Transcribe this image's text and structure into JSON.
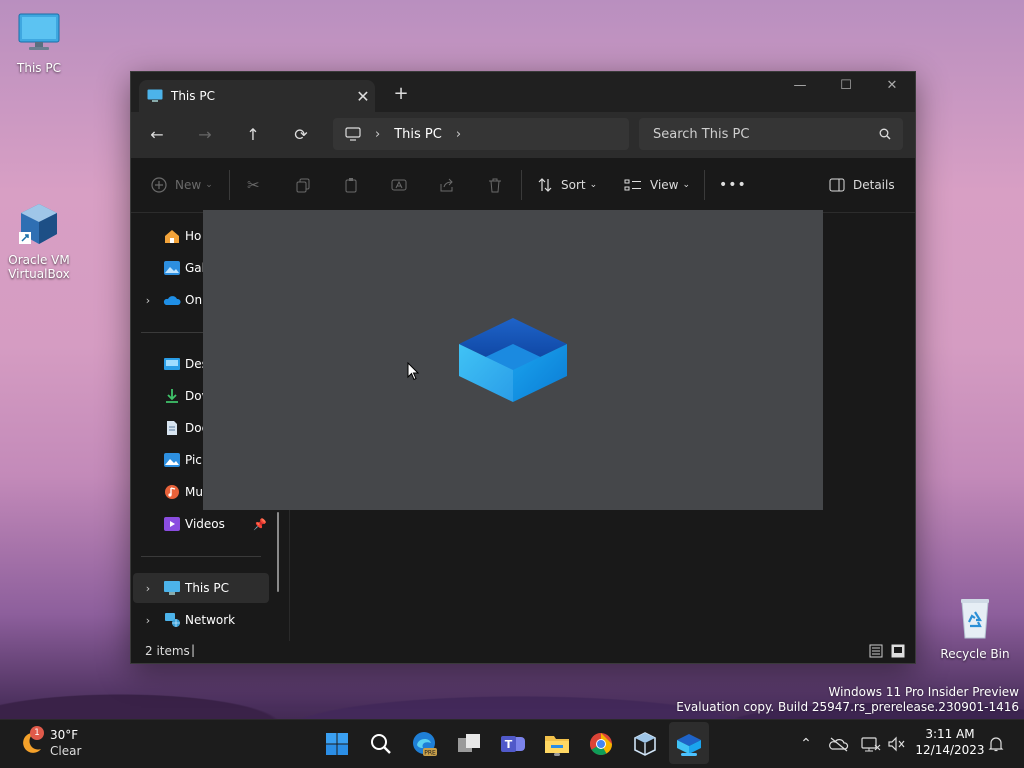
{
  "desktop": {
    "icons": [
      {
        "label": "This PC"
      },
      {
        "label": "Oracle VM VirtualBox"
      },
      {
        "label": "Recycle Bin"
      }
    ],
    "watermark": {
      "line1": "Windows 11 Pro Insider Preview",
      "line2": "Evaluation copy. Build 25947.rs_prerelease.230901-1416"
    }
  },
  "explorer": {
    "tab_title": "This PC",
    "tab_close": "✕",
    "new_tab": "+",
    "window_controls": {
      "minimize": "—",
      "maximize": "☐",
      "close": "✕"
    },
    "nav": {
      "back": "←",
      "forward": "→",
      "up": "↑",
      "refresh": "⟳"
    },
    "address": {
      "separator": "›",
      "location": "This PC",
      "trailing_chevron": "›"
    },
    "search": {
      "placeholder": "Search This PC"
    },
    "command_bar": {
      "new_label": "New",
      "sort_label": "Sort",
      "view_label": "View",
      "more": "•••",
      "details_label": "Details"
    },
    "sidebar": {
      "items": [
        {
          "label": "Ho",
          "icon": "home-icon"
        },
        {
          "label": "Gal",
          "icon": "gallery-icon"
        },
        {
          "label": "On",
          "icon": "onedrive-icon",
          "expandable": true
        },
        {
          "label": "Des",
          "icon": "desktop-folder-icon"
        },
        {
          "label": "Dov",
          "icon": "downloads-icon"
        },
        {
          "label": "Doc",
          "icon": "documents-icon"
        },
        {
          "label": "Pic",
          "icon": "pictures-icon"
        },
        {
          "label": "Mu",
          "icon": "music-icon"
        },
        {
          "label": "Videos",
          "icon": "videos-icon",
          "pinned": true
        },
        {
          "label": "This PC",
          "icon": "computer-icon",
          "expandable": true,
          "selected": true
        },
        {
          "label": "Network",
          "icon": "network-icon",
          "expandable": true
        }
      ]
    },
    "status": {
      "items_count": "2 items",
      "cursor": "|"
    }
  },
  "taskbar": {
    "weather": {
      "temp": "30°F",
      "condition": "Clear",
      "badge": "1"
    },
    "apps": [
      "start-icon",
      "search-icon",
      "edge-beta-icon",
      "task-view-icon",
      "teams-icon",
      "file-explorer-icon",
      "chrome-icon",
      "virtualbox-icon",
      "dev-home-icon"
    ],
    "clock": {
      "time": "3:11 AM",
      "date": "12/14/2023"
    },
    "tray_chevron": "⌃"
  },
  "colors": {
    "accent": "#0078d4",
    "window_bg": "#191919",
    "splash_bg": "#45474a",
    "taskbar_bg": "#1c1c1c"
  }
}
